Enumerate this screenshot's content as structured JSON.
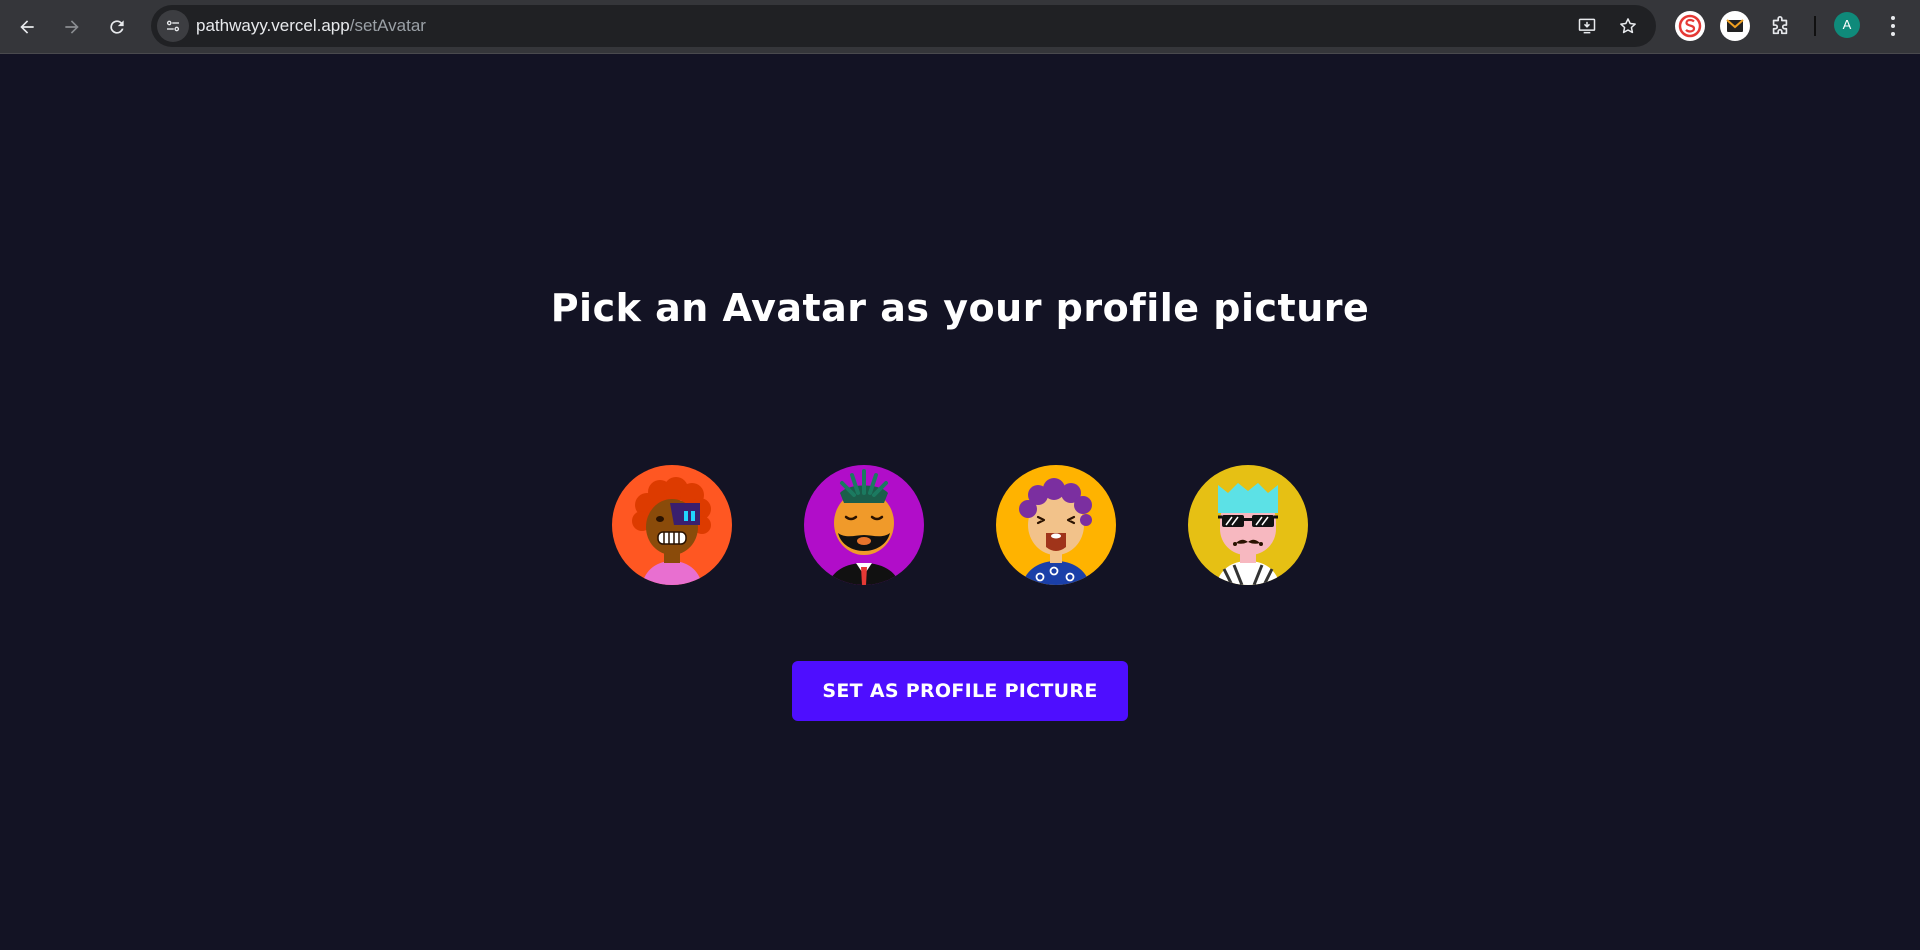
{
  "browser": {
    "url_host": "pathwayy.vercel.app",
    "url_path": "/setAvatar",
    "profile_initial": "A",
    "icons": [
      "back-icon",
      "forward-icon",
      "reload-icon",
      "site-info-icon",
      "install-app-icon",
      "bookmark-star-icon",
      "extension-icon",
      "puzzle-icon",
      "menu-icon"
    ]
  },
  "page": {
    "title": "Pick an Avatar as your profile picture",
    "button_label": "Set as Profile Picture",
    "avatars": [
      {
        "name": "avatar-1",
        "background": "#ff5722"
      },
      {
        "name": "avatar-2",
        "background": "#b10dc9"
      },
      {
        "name": "avatar-3",
        "background": "#ffb300"
      },
      {
        "name": "avatar-4",
        "background": "#e6c014"
      }
    ],
    "colors": {
      "background": "#131324",
      "button": "#4e0eff"
    }
  }
}
